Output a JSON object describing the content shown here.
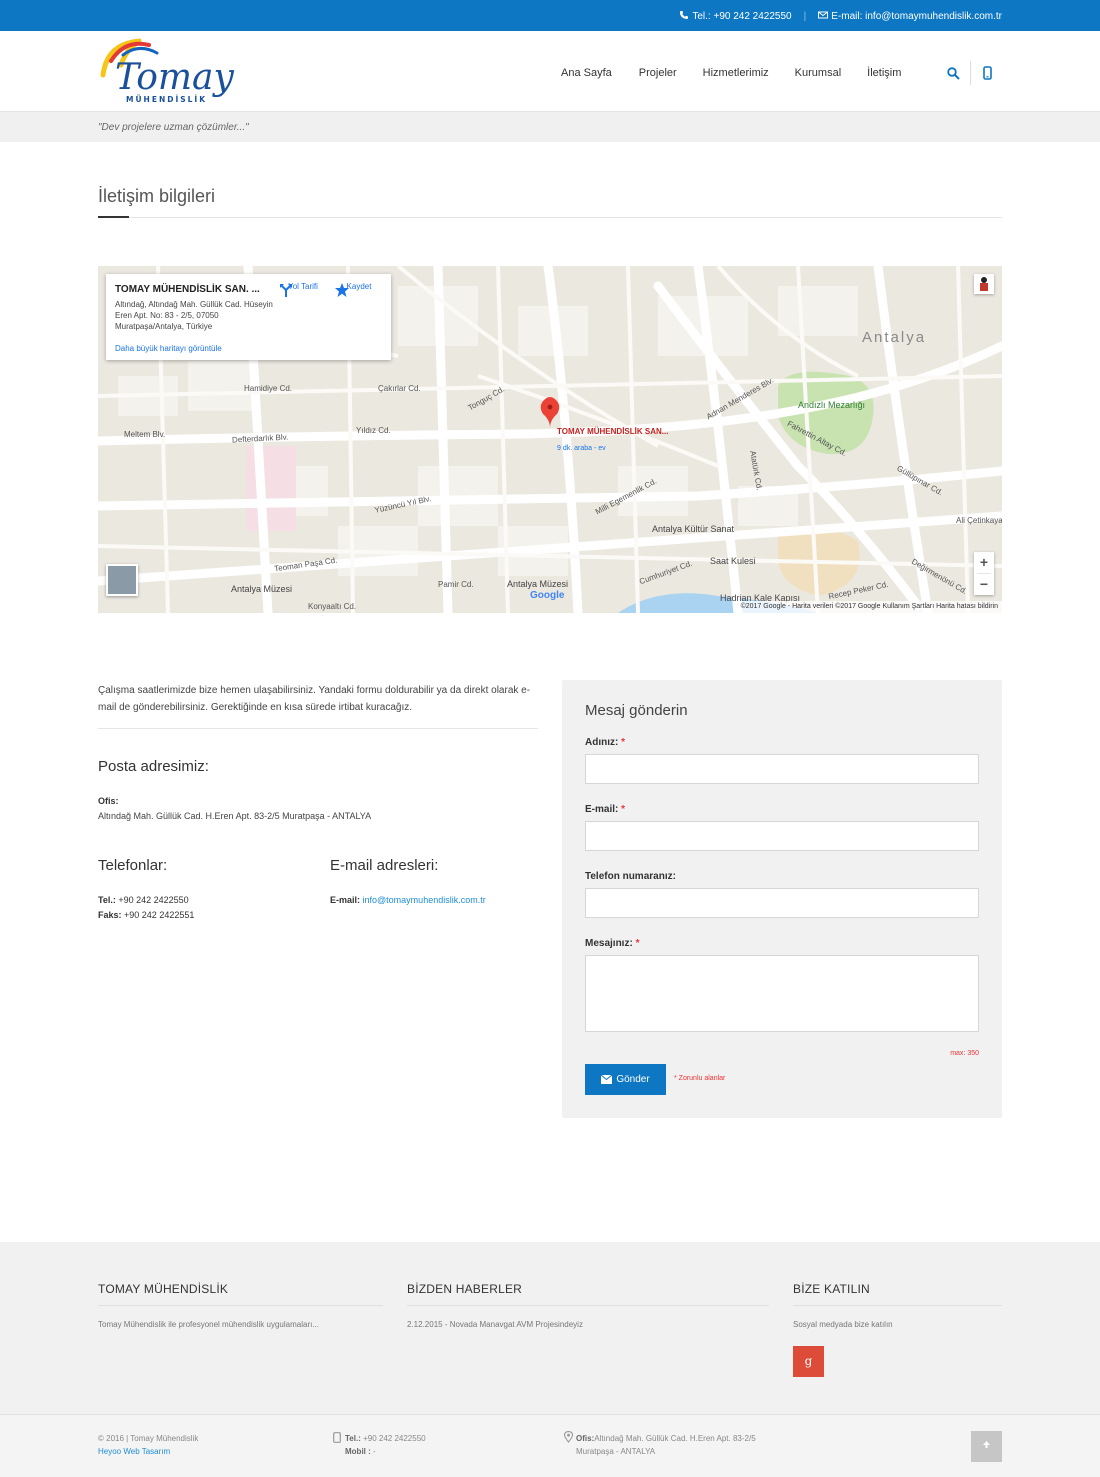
{
  "topbar": {
    "phone_label": "Tel.: +90 242 2422550",
    "separator": "|",
    "email_label": "E-mail: info@tomaymuhendislik.com.tr"
  },
  "logo": {
    "brand": "Tomay",
    "tagline": "MÜHENDİSLİK"
  },
  "nav": {
    "items": [
      "Ana Sayfa",
      "Projeler",
      "Hizmetlerimiz",
      "Kurumsal",
      "İletişim"
    ]
  },
  "slogan": "\"Dev projelere uzman çözümler...\"",
  "page_title": "İletişim bilgileri",
  "map": {
    "card_title": "TOMAY MÜHENDİSLİK SAN. ...",
    "card_address": "Altındağ, Altındağ Mah. Güllük Cad. Hüseyin Eren Apt. No: 83 - 2/5, 07050 Muratpaşa/Antalya, Türkiye",
    "card_link": "Daha büyük haritayı görüntüle",
    "directions_label": "Yol Tarifi",
    "save_label": "Kaydet",
    "pin_label": "TOMAY MÜHENDİSLİK SAN...",
    "pin_sub": "9 dk. araba - ev",
    "city_label": "Antalya",
    "park_label": "Andızlı Mezarlığı",
    "poi": [
      "Antalya Kültür Sanat",
      "Saat Kulesi",
      "Antalya Müzesi",
      "Antalya Müzesi",
      "Hadrian Kale Kapısı"
    ],
    "streets": [
      "Meltem Blv.",
      "Defterdarlık Blv.",
      "Hamidiye Cd.",
      "Çakırlar Cd.",
      "Yıldız Cd.",
      "Tonguç Cd.",
      "Yüzüncü Yıl Blv.",
      "Teoman Paşa Cd.",
      "Milli Egemenlik Cd.",
      "Cumhuriyet Cd.",
      "Adnan Menderes Blv.",
      "Fahrettin Altay Cd.",
      "Güllüpınar Cd.",
      "Ali Çetinkaya Cd.",
      "Konyaaltı Cd.",
      "Pamir Cd.",
      "Recep Peker Cd.",
      "Değirmenönü Cd.",
      "Atatürk Cd."
    ],
    "zoom_in": "+",
    "zoom_out": "−",
    "google": "Google",
    "footer_text": "©2017 Google - Harita verileri ©2017 Google   Kullanım Şartları   Harita hatası bildirin"
  },
  "contact": {
    "intro": "Çalışma saatlerimizde bize hemen ulaşabilirsiniz. Yandaki formu doldurabilir ya da direkt olarak e-mail de gönderebilirsiniz. Gerektiğinde en kısa sürede irtibat kuracağız.",
    "postal_heading": "Posta adresimiz:",
    "office_label": "Ofis:",
    "office_address": "Altındağ Mah. Güllük Cad. H.Eren Apt. 83-2/5 Muratpaşa - ANTALYA",
    "phones_heading": "Telefonlar:",
    "tel_label": "Tel.:",
    "tel_value": "+90 242 2422550",
    "fax_label": "Faks:",
    "fax_value": "+90 242 2422551",
    "emails_heading": "E-mail adresleri:",
    "email_label": "E-mail:",
    "email_value": "info@tomaymuhendislik.com.tr"
  },
  "form": {
    "title": "Mesaj gönderin",
    "name_label": "Adınız:",
    "email_label": "E-mail:",
    "phone_label": "Telefon numaranız:",
    "message_label": "Mesajınız:",
    "required_mark": "*",
    "max_note": "max: 350",
    "submit_label": "Gönder",
    "required_note": "* Zorunlu alanlar"
  },
  "footer": {
    "col1_title": "TOMAY MÜHENDİSLİK",
    "col1_text": "Tomay Mühendislik ile profesyonel mühendislik uygulamaları...",
    "col2_title": "BİZDEN HABERLER",
    "col2_date": "2.12.2015",
    "col2_text": "Novada Manavgat AVM Projesindeyiz",
    "col3_title": "BİZE KATILIN",
    "col3_text": "Sosyal medyada bize katılın",
    "gplus": "g"
  },
  "bottombar": {
    "copyright": "© 2016 | Tomay Mühendislik",
    "credit": "Heyoo Web Tasarım",
    "tel_label": "Tel.:",
    "tel_value": "+90 242 2422550",
    "mobile_label": "Mobil :",
    "mobile_value": "-",
    "office_label": "Ofis:",
    "office_line1": "Altındağ Mah. Güllük Cad. H.Eren Apt. 83-2/5",
    "office_line2": "Muratpaşa - ANTALYA"
  },
  "colors": {
    "brand_blue": "#0d77c3",
    "gplus_red": "#dd4b39",
    "required_red": "#ee3333"
  }
}
